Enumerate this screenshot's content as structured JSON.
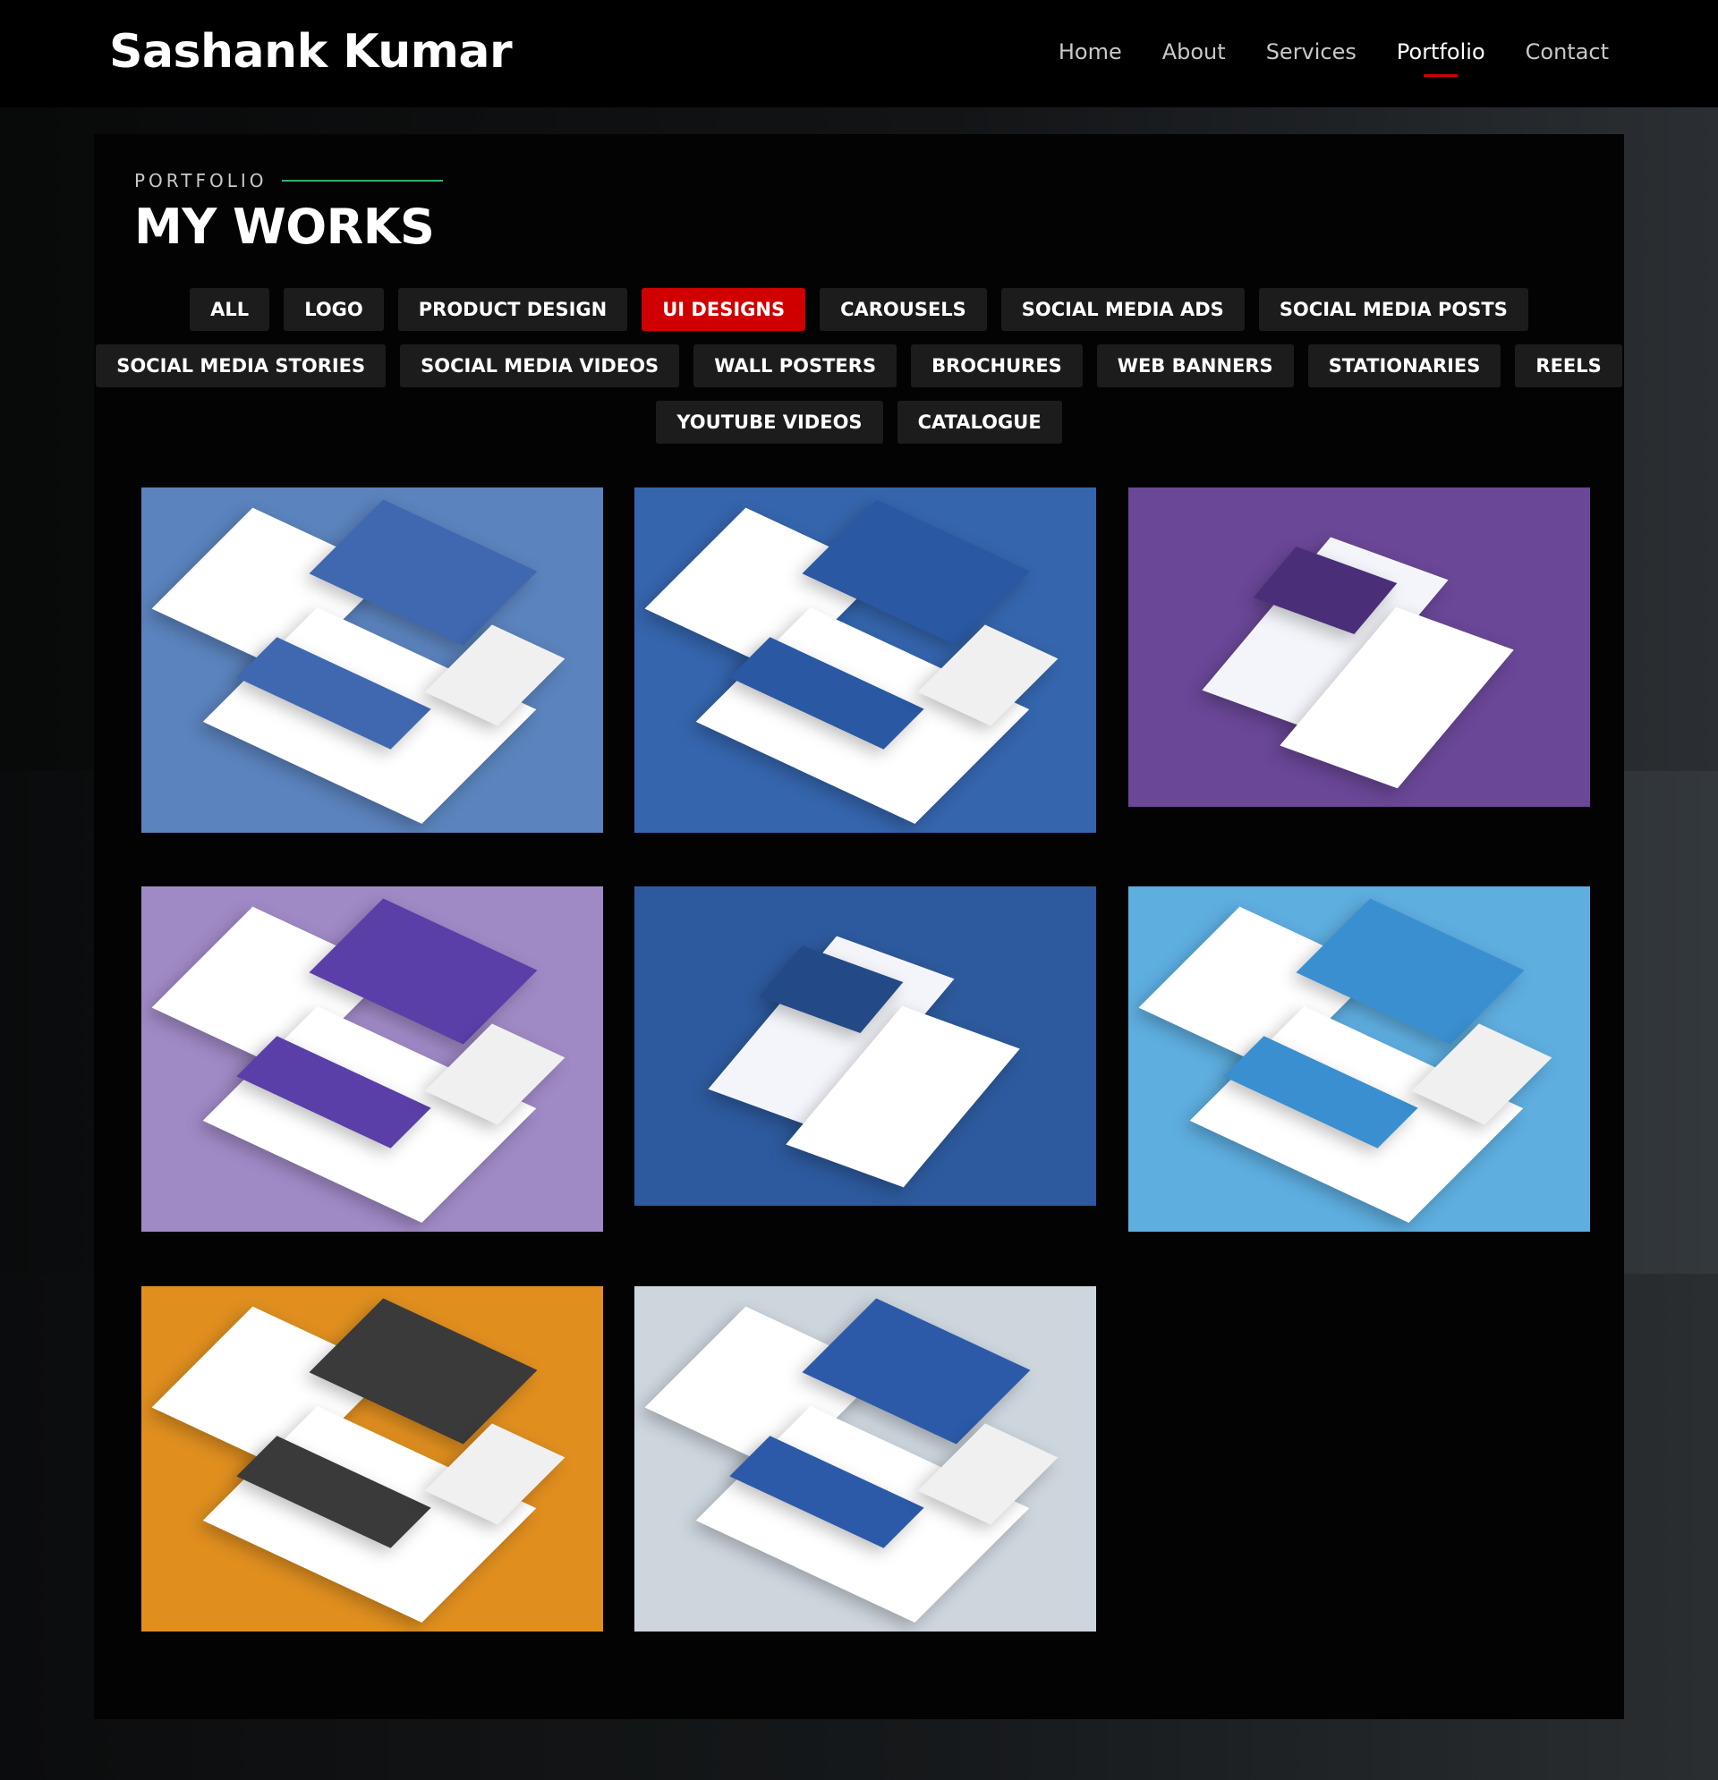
{
  "brand": "Sashank Kumar",
  "nav": [
    {
      "label": "Home",
      "active": false
    },
    {
      "label": "About",
      "active": false
    },
    {
      "label": "Services",
      "active": false
    },
    {
      "label": "Portfolio",
      "active": true
    },
    {
      "label": "Contact",
      "active": false
    }
  ],
  "section": {
    "eyebrow": "PORTFOLIO",
    "title": "MY WORKS"
  },
  "filters": {
    "rows": [
      [
        "ALL",
        "LOGO",
        "PRODUCT DESIGN",
        "UI DESIGNS",
        "CAROUSELS",
        "SOCIAL MEDIA ADS",
        "SOCIAL MEDIA POSTS"
      ],
      [
        "SOCIAL MEDIA STORIES",
        "SOCIAL MEDIA VIDEOS",
        "WALL POSTERS",
        "BROCHURES",
        "WEB BANNERS",
        "STATIONARIES",
        "REELS"
      ],
      [
        "YOUTUBE VIDEOS",
        "CATALOGUE"
      ]
    ],
    "active": "UI DESIGNS"
  },
  "colors": {
    "accent_red": "#d10000",
    "eyebrow_line": "#2fb36a",
    "filter_bg": "#1c1c1c"
  },
  "works": [
    {
      "bg": "#5b83bd",
      "accent": "#3f68b0",
      "kind": "layered"
    },
    {
      "bg": "#3565ad",
      "accent": "#2a58a3",
      "kind": "layered"
    },
    {
      "bg": "#6a4797",
      "accent": "#4a2f78",
      "kind": "folded"
    },
    {
      "bg": "#a08ac6",
      "accent": "#5a3fa8",
      "kind": "layered"
    },
    {
      "bg": "#2d5a9e",
      "accent": "#234a86",
      "kind": "folded"
    },
    {
      "bg": "#5eaee0",
      "accent": "#3a8fd0",
      "kind": "layered"
    },
    {
      "bg": "#e08f1f",
      "accent": "#3a3a3a",
      "kind": "layered"
    },
    {
      "bg": "#cdd5dd",
      "accent": "#2c5aa8",
      "kind": "layered"
    }
  ]
}
